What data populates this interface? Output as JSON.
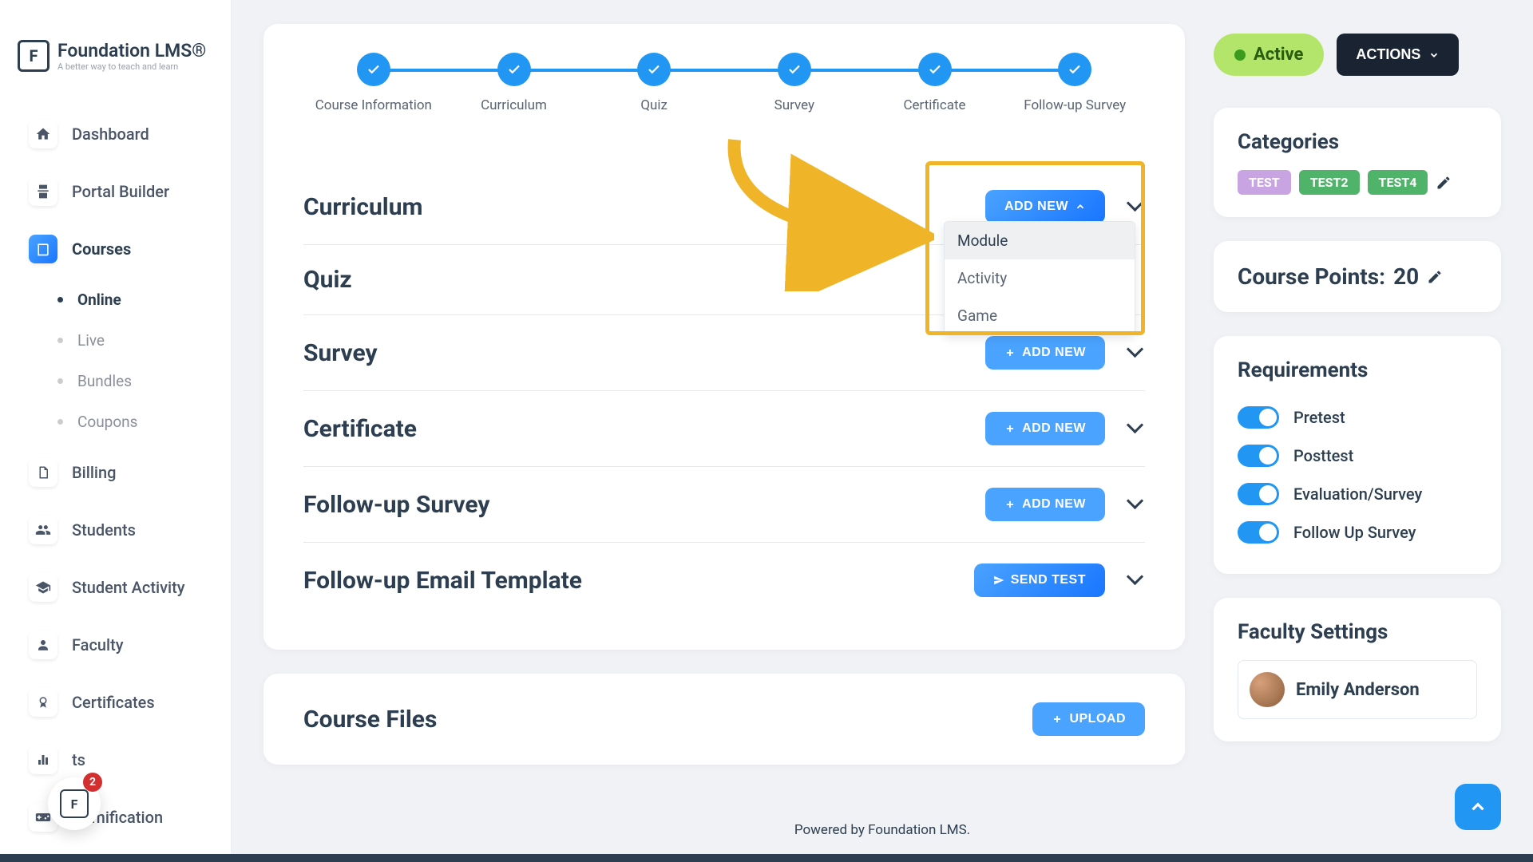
{
  "brand": {
    "title": "Foundation LMS®",
    "subtitle": "A better way to teach and learn"
  },
  "nav": {
    "dashboard": "Dashboard",
    "portal_builder": "Portal Builder",
    "courses": "Courses",
    "courses_sub": {
      "online": "Online",
      "live": "Live",
      "bundles": "Bundles",
      "coupons": "Coupons"
    },
    "billing": "Billing",
    "students": "Students",
    "student_activity": "Student Activity",
    "faculty": "Faculty",
    "certificates": "Certificates",
    "reports_partial": "ts",
    "gamification": "Gamification"
  },
  "stepper": {
    "course_info": "Course Information",
    "curriculum": "Curriculum",
    "quiz": "Quiz",
    "survey": "Survey",
    "certificate": "Certificate",
    "followup": "Follow-up Survey"
  },
  "sections": {
    "curriculum": "Curriculum",
    "quiz": "Quiz",
    "survey": "Survey",
    "certificate": "Certificate",
    "followup_survey": "Follow-up Survey",
    "followup_email": "Follow-up Email Template",
    "course_files": "Course Files"
  },
  "buttons": {
    "add_new": "ADD NEW",
    "send_test": "SEND TEST",
    "upload": "UPLOAD",
    "actions": "ACTIONS"
  },
  "dropdown": {
    "module": "Module",
    "activity": "Activity",
    "game": "Game"
  },
  "status": {
    "active": "Active"
  },
  "categories": {
    "title": "Categories",
    "tags": [
      {
        "label": "TEST",
        "color": "#c8a4e3"
      },
      {
        "label": "TEST2",
        "color": "#4fb36a"
      },
      {
        "label": "TEST4",
        "color": "#4fb36a"
      }
    ]
  },
  "points": {
    "label": "Course Points:",
    "value": "20"
  },
  "requirements": {
    "title": "Requirements",
    "pretest": "Pretest",
    "posttest": "Posttest",
    "evaluation": "Evaluation/Survey",
    "followup": "Follow Up Survey"
  },
  "faculty_settings": {
    "title": "Faculty Settings",
    "name": "Emily Anderson"
  },
  "footer": "Powered by Foundation LMS.",
  "fab_badge": "2"
}
